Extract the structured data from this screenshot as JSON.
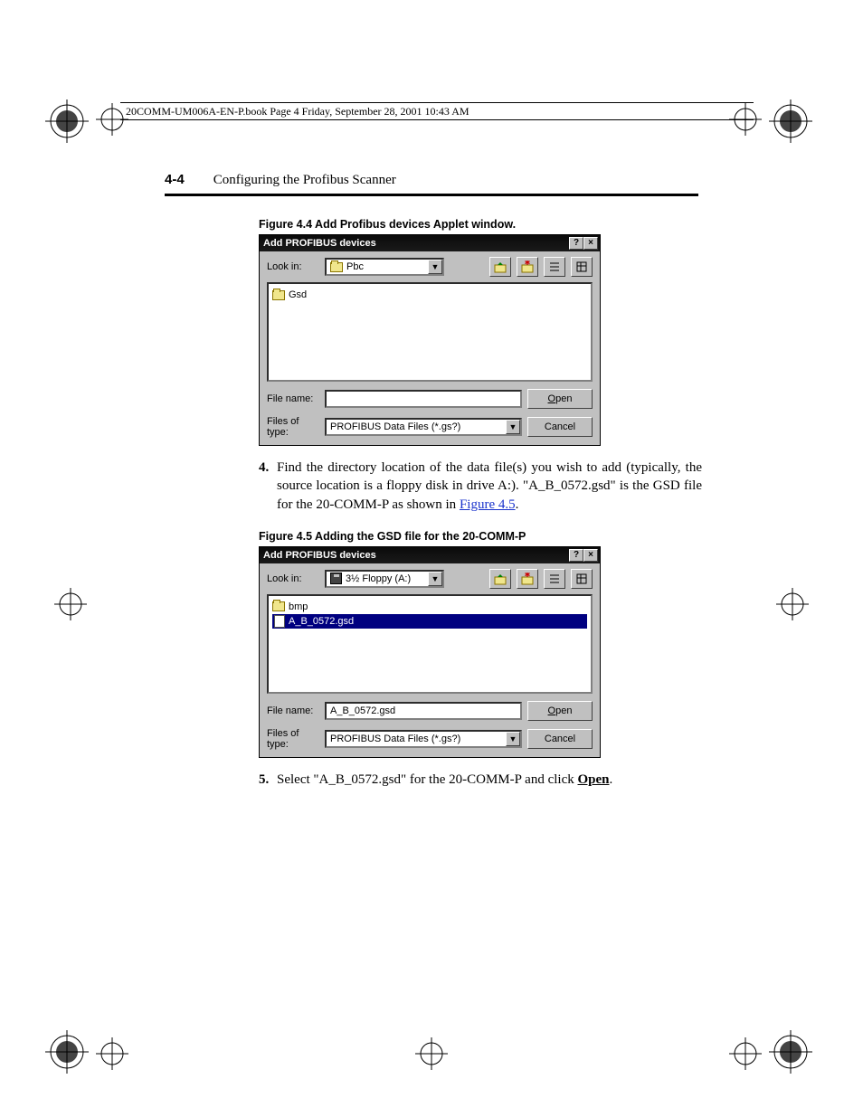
{
  "header": {
    "text": "20COMM-UM006A-EN-P.book  Page 4  Friday, September 28, 2001  10:43 AM"
  },
  "page": {
    "number": "4-4",
    "chapter": "Configuring the Profibus Scanner"
  },
  "fig44": {
    "caption": "Figure 4.4   Add Profibus devices Applet window.",
    "title": "Add PROFIBUS devices",
    "lookin_label": "Look in:",
    "lookin_value": "Pbc",
    "list_item": "Gsd",
    "filename_label": "File name:",
    "filename_value": "",
    "filetype_label": "Files of type:",
    "filetype_value": "PROFIBUS Data Files (*.gs?)",
    "open": "Open",
    "cancel": "Cancel",
    "help_btn": "?",
    "close_btn": "×"
  },
  "step4": {
    "num": "4.",
    "text1": "Find the directory location of the data file(s) you wish to add (typically, the source location is a floppy disk in drive A:). \"A_B_0572.gsd\" is the GSD file for the 20-COMM-P as shown in ",
    "link": "Figure 4.5",
    "text2": "."
  },
  "fig45": {
    "caption": "Figure 4.5   Adding the GSD file for the 20-COMM-P",
    "title": "Add PROFIBUS devices",
    "lookin_label": "Look in:",
    "lookin_value": "3½ Floppy (A:)",
    "list_item1": "bmp",
    "list_item2": "A_B_0572.gsd",
    "filename_label": "File name:",
    "filename_value": "A_B_0572.gsd",
    "filetype_label": "Files of type:",
    "filetype_value": "PROFIBUS Data Files (*.gs?)",
    "open": "Open",
    "cancel": "Cancel",
    "help_btn": "?",
    "close_btn": "×"
  },
  "step5": {
    "num": "5.",
    "text1": "Select \"A_B_0572.gsd\" for the 20-COMM-P and click ",
    "open_word": "Open",
    "text2": "."
  }
}
